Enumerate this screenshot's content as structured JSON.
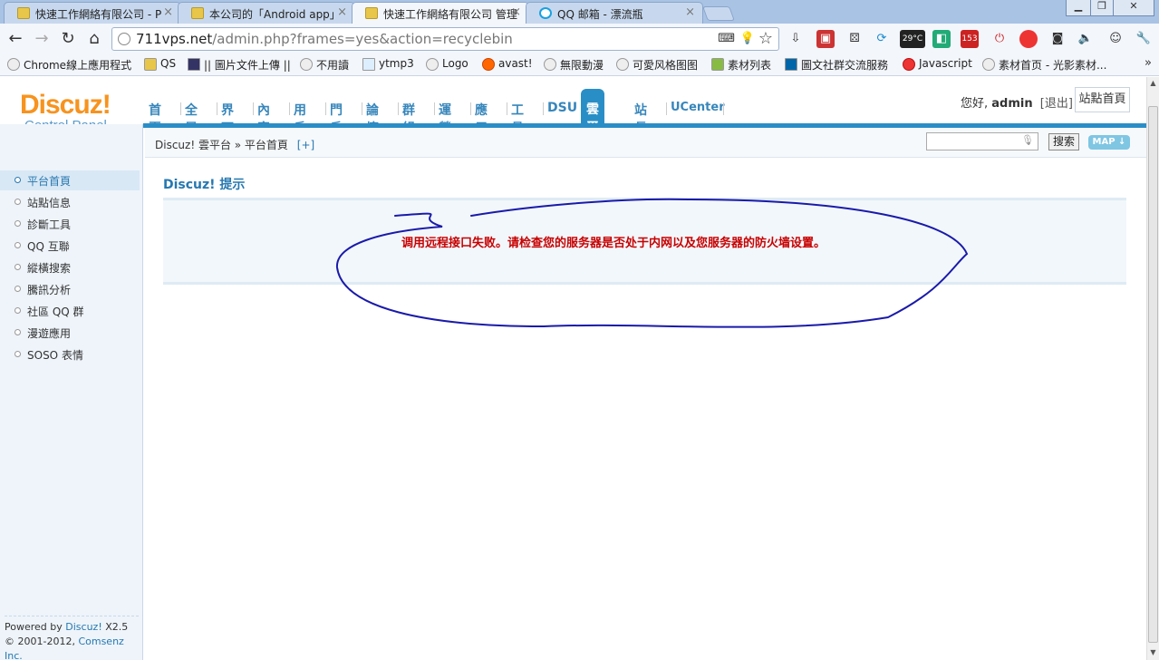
{
  "browser": {
    "tabs": [
      {
        "title": "快速工作網絡有限公司 - P"
      },
      {
        "title": "本公司的「Android app」"
      },
      {
        "title": "快速工作網絡有限公司 管理"
      },
      {
        "title": "QQ 邮箱 - 漂流瓶"
      }
    ],
    "url_host": "711vps.net",
    "url_path": "/admin.php?frames=yes&action=recyclebin",
    "ext_badge_temp": "29°C",
    "ext_badge_mail": "153",
    "bookmarks": [
      "Chrome線上應用程式",
      "QS",
      "|| 圖片文件上傳 ||",
      "不用讀",
      "ytmp3",
      "Logo",
      "avast!",
      "無限動漫",
      "可愛风格图图",
      "素材列表",
      "圖文社群交流服務",
      "Javascript",
      "素材首页 - 光影素材..."
    ],
    "bookmarks_more": "»"
  },
  "header": {
    "logo_brand": "Discuz!",
    "logo_sub": "Control Panel",
    "nav": [
      "首頁",
      "全局",
      "界面",
      "內容",
      "用戶",
      "門戶",
      "論壇",
      "群組",
      "運營",
      "應用",
      "工具",
      "DSU",
      "雲平台",
      "站長",
      "UCenter"
    ],
    "nav_active_index": 12,
    "greeting": "您好,",
    "username": "admin",
    "logout": "[退出]",
    "site_home": "站點首頁"
  },
  "sidebar": {
    "items": [
      "平台首頁",
      "站點信息",
      "診斷工具",
      "QQ 互聯",
      "縱橫搜索",
      "騰訊分析",
      "社區 QQ 群",
      "漫遊應用",
      "SOSO 表情"
    ],
    "active_index": 0,
    "powered_prefix": "Powered by",
    "powered_link": "Discuz!",
    "powered_version": "X2.5",
    "copyright_prefix": "© 2001-2012,",
    "copyright_link": "Comsenz Inc."
  },
  "content": {
    "breadcrumb": "Discuz! 雲平台 » 平台首頁",
    "breadcrumb_plus": "[+]",
    "search_button": "搜索",
    "map_button": "MAP ↓",
    "notice_title": "Discuz! 提示",
    "notice_message": "调用远程接口失败。请检查您的服务器是否处于内网以及您服务器的防火墙设置。"
  },
  "colors": {
    "accent": "#2a8ec6",
    "logo_orange": "#f7931e",
    "error_red": "#c80000",
    "annotation_blue": "#1a1aaa"
  }
}
